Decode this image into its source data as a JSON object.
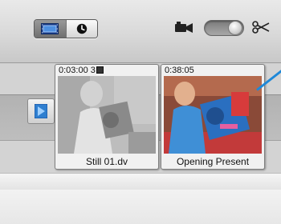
{
  "toolbar": {
    "view_buttons": [
      "clip-viewer",
      "timeline-viewer"
    ],
    "icons": [
      "filmstrip-icon",
      "clock-icon",
      "camera-icon",
      "toggle-switch",
      "scissors-icon"
    ]
  },
  "clips": [
    {
      "duration": "0:03:00 3",
      "name": "Still 01.dv",
      "badge_icon": "still-image-icon"
    },
    {
      "duration": "0:38:05",
      "name": "Opening Present"
    }
  ],
  "colors": {
    "accent_blue": "#1e88d8",
    "playhead_tab": "#2f7fd0"
  }
}
